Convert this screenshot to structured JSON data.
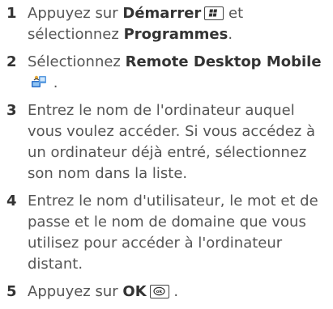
{
  "steps": [
    {
      "num": "1",
      "t1": "Appuyez sur ",
      "b1": "Démarrer",
      "t2": " et sélectionnez ",
      "b2": "Programmes",
      "t3": "."
    },
    {
      "num": "2",
      "t1": "Sélectionnez ",
      "b1": "Remote Desktop Mobile",
      "t2": " ."
    },
    {
      "num": "3",
      "t1": "Entrez le nom de l'ordinateur auquel vous voulez accéder. Si vous accédez à un ordinateur déjà entré, sélectionnez son nom dans la liste."
    },
    {
      "num": "4",
      "t1": "Entrez le nom d'utilisateur, le mot et de passe et le nom de domaine que vous utilisez pour accéder à l'ordinateur distant."
    },
    {
      "num": "5",
      "t1": "Appuyez sur ",
      "b1": "OK",
      "t2": " ."
    }
  ],
  "icons": {
    "start_key": "windows-start-key-icon",
    "remote_desktop": "remote-desktop-mobile-icon",
    "ok_key": "ok-key-icon"
  }
}
